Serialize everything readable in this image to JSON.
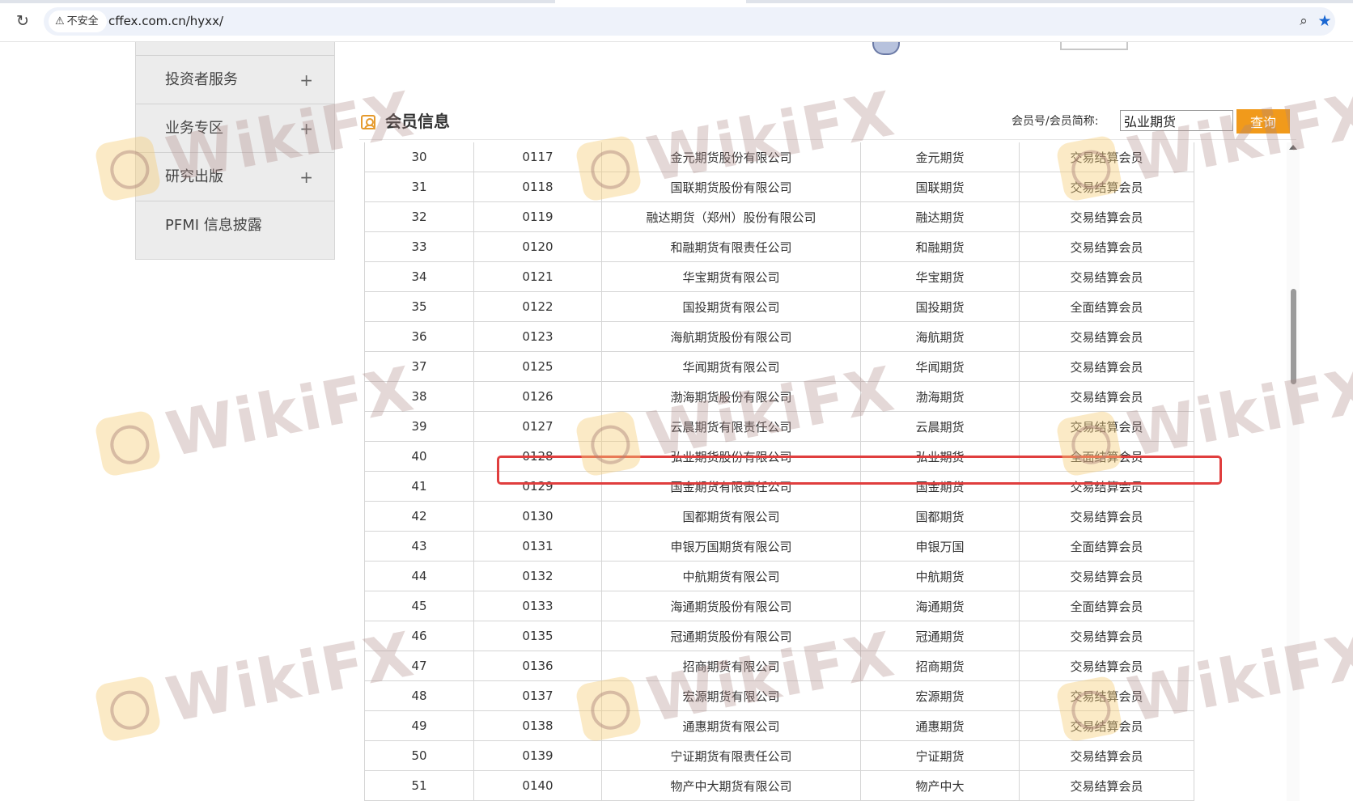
{
  "browser": {
    "security_label": "不安全",
    "url": "cffex.com.cn/hyxx/"
  },
  "sidebar": {
    "items": [
      {
        "label": "投资者服务",
        "has_expand": true
      },
      {
        "label": "业务专区",
        "has_expand": true
      },
      {
        "label": "研究出版",
        "has_expand": true
      },
      {
        "label": "PFMI 信息披露",
        "has_expand": false
      }
    ],
    "expand_symbol": "+"
  },
  "section": {
    "title": "会员信息",
    "search_label": "会员号/会员简称:",
    "search_value": "弘业期货",
    "search_button": "查询"
  },
  "table": {
    "rows": [
      [
        "30",
        "0117",
        "金元期货股份有限公司",
        "金元期货",
        "交易结算会员"
      ],
      [
        "31",
        "0118",
        "国联期货股份有限公司",
        "国联期货",
        "交易结算会员"
      ],
      [
        "32",
        "0119",
        "融达期货（郑州）股份有限公司",
        "融达期货",
        "交易结算会员"
      ],
      [
        "33",
        "0120",
        "和融期货有限责任公司",
        "和融期货",
        "交易结算会员"
      ],
      [
        "34",
        "0121",
        "华宝期货有限公司",
        "华宝期货",
        "交易结算会员"
      ],
      [
        "35",
        "0122",
        "国投期货有限公司",
        "国投期货",
        "全面结算会员"
      ],
      [
        "36",
        "0123",
        "海航期货股份有限公司",
        "海航期货",
        "交易结算会员"
      ],
      [
        "37",
        "0125",
        "华闻期货有限公司",
        "华闻期货",
        "交易结算会员"
      ],
      [
        "38",
        "0126",
        "渤海期货股份有限公司",
        "渤海期货",
        "交易结算会员"
      ],
      [
        "39",
        "0127",
        "云晨期货有限责任公司",
        "云晨期货",
        "交易结算会员"
      ],
      [
        "40",
        "0128",
        "弘业期货股份有限公司",
        "弘业期货",
        "全面结算会员"
      ],
      [
        "41",
        "0129",
        "国金期货有限责任公司",
        "国金期货",
        "交易结算会员"
      ],
      [
        "42",
        "0130",
        "国都期货有限公司",
        "国都期货",
        "交易结算会员"
      ],
      [
        "43",
        "0131",
        "申银万国期货有限公司",
        "申银万国",
        "全面结算会员"
      ],
      [
        "44",
        "0132",
        "中航期货有限公司",
        "中航期货",
        "交易结算会员"
      ],
      [
        "45",
        "0133",
        "海通期货股份有限公司",
        "海通期货",
        "全面结算会员"
      ],
      [
        "46",
        "0135",
        "冠通期货股份有限公司",
        "冠通期货",
        "交易结算会员"
      ],
      [
        "47",
        "0136",
        "招商期货有限公司",
        "招商期货",
        "交易结算会员"
      ],
      [
        "48",
        "0137",
        "宏源期货有限公司",
        "宏源期货",
        "交易结算会员"
      ],
      [
        "49",
        "0138",
        "通惠期货有限公司",
        "通惠期货",
        "交易结算会员"
      ],
      [
        "50",
        "0139",
        "宁证期货有限责任公司",
        "宁证期货",
        "交易结算会员"
      ],
      [
        "51",
        "0140",
        "物产中大期货有限公司",
        "物产中大",
        "交易结算会员"
      ]
    ],
    "highlighted_row": 10
  },
  "watermark": {
    "text": "WikiFX",
    "badge_color": "#f6cd78"
  },
  "colors": {
    "accent": "#f19a1b",
    "highlight": "#e03e3e",
    "link_star": "#1a67d2"
  }
}
